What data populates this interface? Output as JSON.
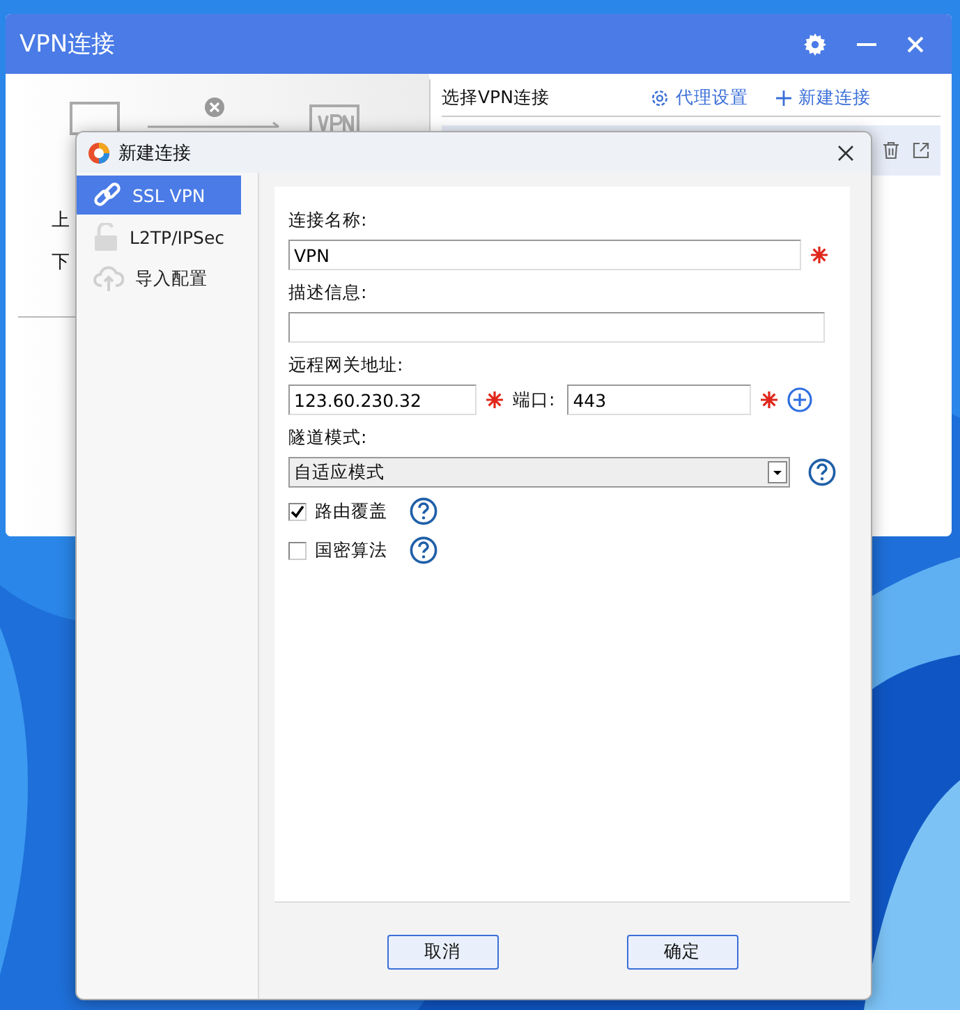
{
  "main_window": {
    "title": "VPN连接",
    "upload_label": "上",
    "download_label": "下",
    "panel": {
      "title": "选择VPN连接",
      "actions": [
        "代理设置",
        "新建连接"
      ]
    }
  },
  "dialog": {
    "title": "新建连接",
    "nav": [
      {
        "label": "SSL VPN",
        "selected": true
      },
      {
        "label": "L2TP/IPSec",
        "selected": false
      },
      {
        "label": "导入配置",
        "selected": false
      }
    ],
    "form": {
      "name": {
        "label": "连接名称:",
        "value": "VPN",
        "required": true
      },
      "description": {
        "label": "描述信息:"
      },
      "gateway": {
        "label": "远程网关地址:",
        "value": "123.60.230.32",
        "required": true
      },
      "port": {
        "label": "端口:",
        "value": "443",
        "required": true
      },
      "tunnel_mode": {
        "label": "隧道模式:",
        "value": "自适应模式"
      },
      "options": [
        {
          "label": "路由覆盖",
          "checked": true
        },
        {
          "label": "国密算法",
          "checked": false
        }
      ]
    },
    "buttons": [
      "取消",
      "确定"
    ]
  }
}
